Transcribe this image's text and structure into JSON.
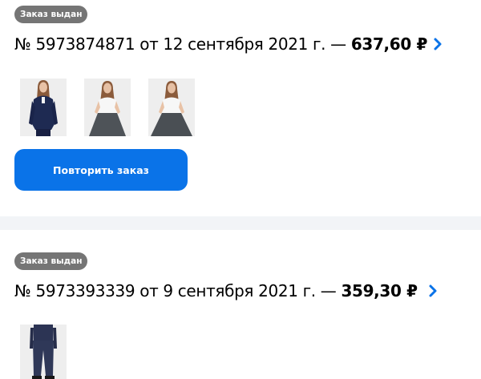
{
  "orders": [
    {
      "status_badge": "Заказ выдан",
      "title_prefix": "№ 5973874871 от 12 сентября 2021 г. — ",
      "total": "637,60 ₽",
      "items": [
        {
          "icon": "girl-in-navy-cardigan-thumbnail"
        },
        {
          "icon": "girl-in-white-blouse-grey-skirt-thumbnail"
        },
        {
          "icon": "girl-in-white-blouse-grey-skirt-thumbnail"
        }
      ],
      "repeat_button_label": "Повторить заказ"
    },
    {
      "status_badge": "Заказ выдан",
      "title_prefix": "№ 5973393339 от 9 сентября 2021 г. — ",
      "total": "359,30 ₽",
      "items": [
        {
          "icon": "navy-school-trousers-thumbnail"
        }
      ]
    }
  ],
  "colors": {
    "accent": "#0a73e8",
    "badge": "#757575",
    "separator": "#f2f4f7"
  },
  "icons": {
    "chevron": "chevron-right-icon"
  }
}
